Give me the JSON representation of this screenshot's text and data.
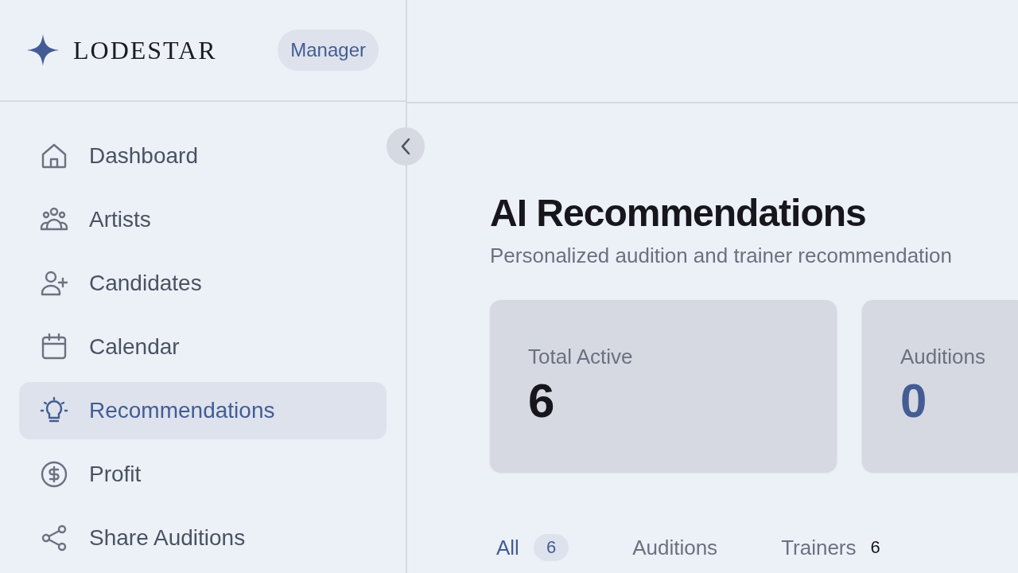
{
  "brand": {
    "name": "LODESTAR",
    "role": "Manager"
  },
  "sidebar": {
    "items": [
      {
        "label": "Dashboard",
        "selected": false
      },
      {
        "label": "Artists",
        "selected": false
      },
      {
        "label": "Candidates",
        "selected": false
      },
      {
        "label": "Calendar",
        "selected": false
      },
      {
        "label": "Recommendations",
        "selected": true
      },
      {
        "label": "Profit",
        "selected": false
      },
      {
        "label": "Share Auditions",
        "selected": false
      }
    ]
  },
  "page": {
    "title": "AI Recommendations",
    "subtitle": "Personalized audition and trainer recommendation"
  },
  "stats": [
    {
      "label": "Total Active",
      "value": "6",
      "accent": false
    },
    {
      "label": "Auditions",
      "value": "0",
      "accent": true
    }
  ],
  "tabs": [
    {
      "label": "All",
      "count": "6",
      "selected": true
    },
    {
      "label": "Auditions",
      "selected": false
    },
    {
      "label": "Trainers",
      "count": "6",
      "selected": false
    }
  ]
}
